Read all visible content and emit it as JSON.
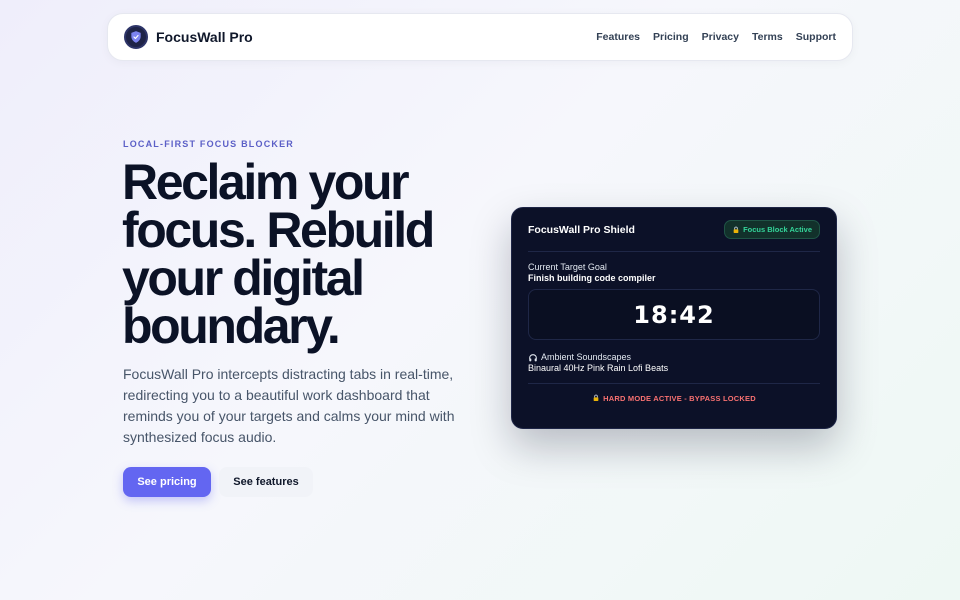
{
  "navbar": {
    "brand_name": "FocusWall Pro",
    "links": [
      "Features",
      "Pricing",
      "Privacy",
      "Terms",
      "Support"
    ]
  },
  "hero": {
    "eyebrow": "LOCAL-FIRST FOCUS BLOCKER",
    "headline": "Reclaim your focus. Rebuild your digital boundary.",
    "lead": "FocusWall Pro intercepts distracting tabs in real-time, redirecting you to a beautiful work dashboard that reminds you of your targets and calms your mind with synthesized focus audio.",
    "primary_cta": "See pricing",
    "secondary_cta": "See features"
  },
  "card": {
    "title": "FocusWall Pro Shield",
    "badge": "Focus Block Active",
    "goal_label": "Current Target Goal",
    "goal_value": "Finish building code compiler",
    "timer": "18:42",
    "sound_label": "Ambient Soundscapes",
    "sound_tracks": "Binaural 40Hz Pink Rain Lofi Beats",
    "footer": "HARD MODE ACTIVE - BYPASS LOCKED"
  },
  "colors": {
    "accent": "#6366f1",
    "card_bg": "#0c1128",
    "success": "#34d399",
    "danger": "#f87171"
  },
  "icons": {
    "brand": "shield-icon",
    "badge": "lock-icon",
    "sound": "headphones-icon",
    "footer": "lock-icon"
  }
}
